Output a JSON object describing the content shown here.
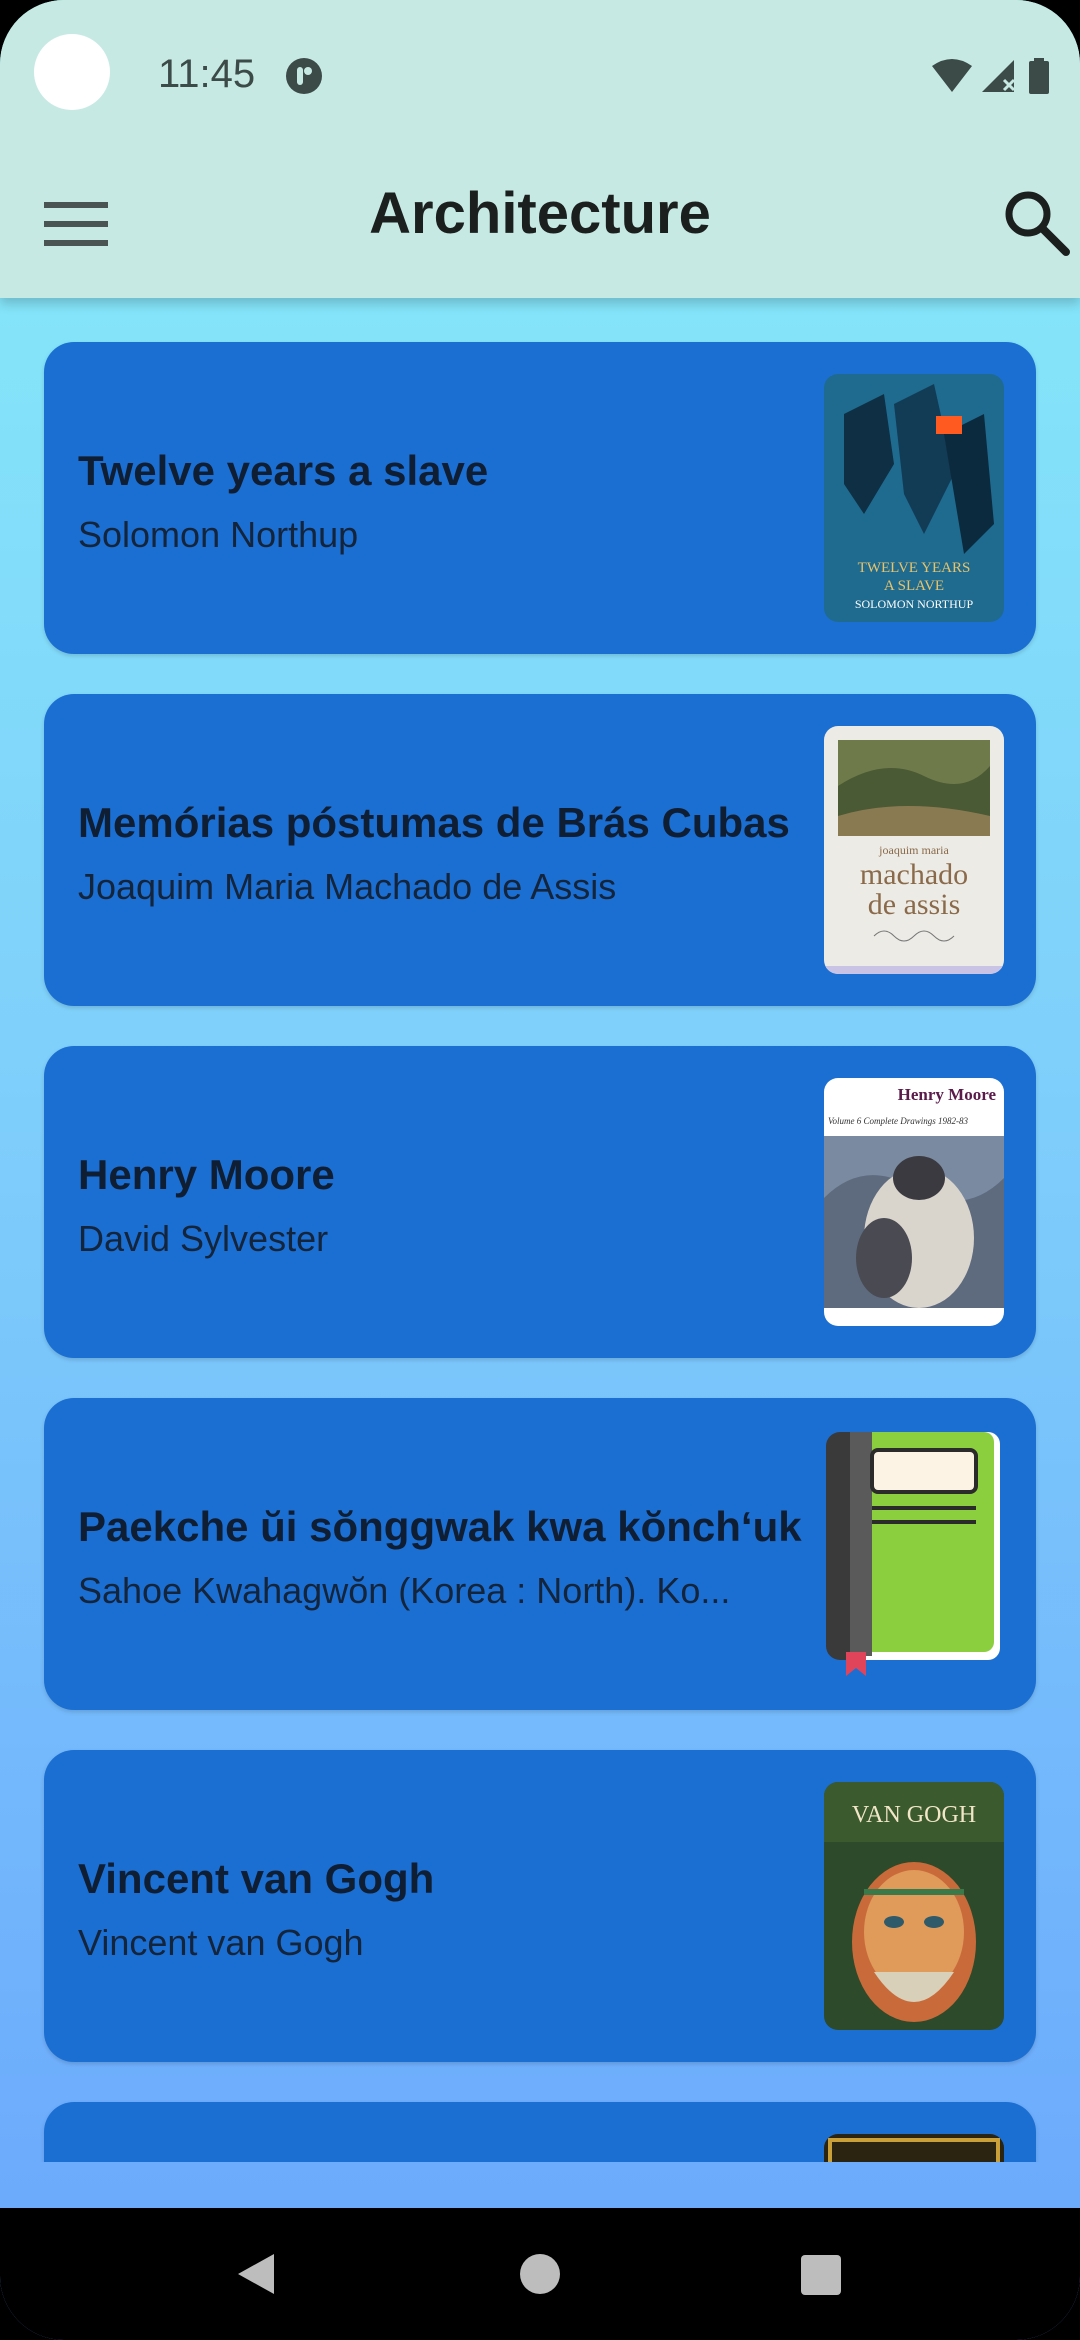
{
  "status_bar": {
    "time": "11:45"
  },
  "app_bar": {
    "title": "Architecture"
  },
  "books": [
    {
      "title": "Twelve years a slave",
      "author": "Solomon Northup",
      "cover_text_1": "TWELVE YEARS",
      "cover_text_2": "A SLAVE",
      "cover_text_3": "SOLOMON NORTHUP"
    },
    {
      "title": "Memórias póstumas de Brás Cubas",
      "author": "Joaquim Maria Machado de Assis",
      "cover_text_1": "joaquim maria",
      "cover_text_2": "machado",
      "cover_text_3": "de assis"
    },
    {
      "title": "Henry Moore",
      "author": "David Sylvester",
      "cover_text_1": "Henry Moore",
      "cover_text_2": "Volume 6   Complete Drawings 1982-83"
    },
    {
      "title": "Paekche ŭi sŏnggwak kwa kŏnch‘uk",
      "author": "Sahoe Kwahagwŏn (Korea : North). Ko..."
    },
    {
      "title": "Vincent van Gogh",
      "author": "Vincent van Gogh",
      "cover_text_1": "VAN GOGH"
    }
  ],
  "colors": {
    "card": "#1b6fd2",
    "app_bar": "#c6eae3"
  }
}
